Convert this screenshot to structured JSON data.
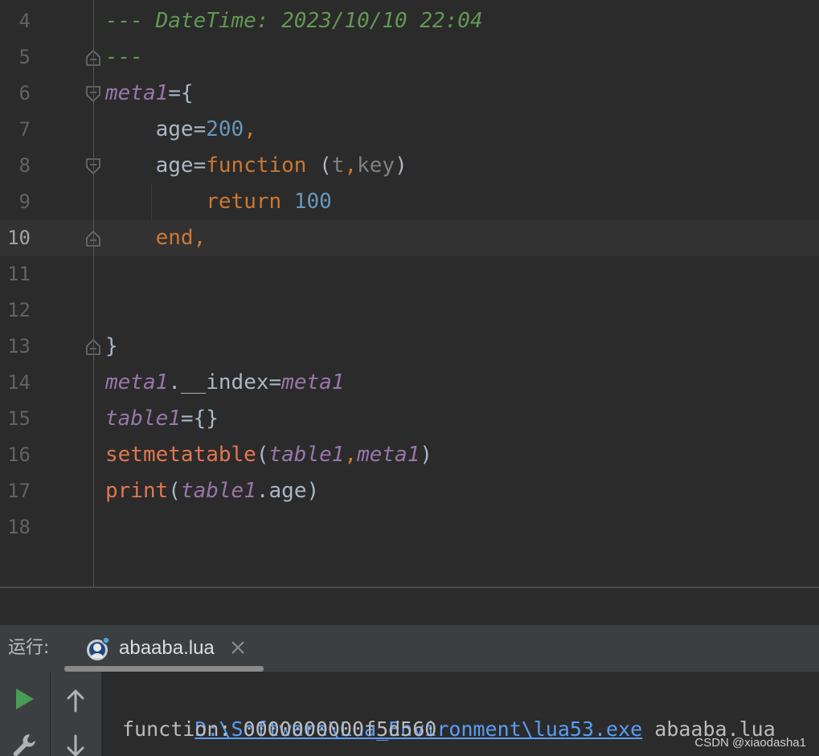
{
  "editor": {
    "lines": [
      {
        "num": "4",
        "tokens": [
          {
            "t": "--- DateTime: 2023/10/10 22:04",
            "c": "comment"
          }
        ]
      },
      {
        "num": "5",
        "tokens": [
          {
            "t": "---",
            "c": "comment"
          }
        ]
      },
      {
        "num": "6",
        "tokens": [
          {
            "t": "meta1",
            "c": "var"
          },
          {
            "t": "={",
            "c": "plain"
          }
        ]
      },
      {
        "num": "7",
        "tokens": [
          {
            "t": "    age=",
            "c": "plain"
          },
          {
            "t": "200",
            "c": "num"
          },
          {
            "t": ",",
            "c": "kw"
          }
        ]
      },
      {
        "num": "8",
        "tokens": [
          {
            "t": "    age=",
            "c": "plain"
          },
          {
            "t": "function",
            "c": "kw"
          },
          {
            "t": " (",
            "c": "plain"
          },
          {
            "t": "t",
            "c": "par"
          },
          {
            "t": ",",
            "c": "kw"
          },
          {
            "t": "key",
            "c": "par"
          },
          {
            "t": ")",
            "c": "plain"
          }
        ]
      },
      {
        "num": "9",
        "tokens": [
          {
            "t": "        ",
            "c": "plain"
          },
          {
            "t": "return",
            "c": "kw"
          },
          {
            "t": " ",
            "c": "plain"
          },
          {
            "t": "100",
            "c": "num"
          }
        ]
      },
      {
        "num": "10",
        "tokens": [
          {
            "t": "    ",
            "c": "plain"
          },
          {
            "t": "end,",
            "c": "kw"
          }
        ],
        "current": true
      },
      {
        "num": "11",
        "tokens": []
      },
      {
        "num": "12",
        "tokens": []
      },
      {
        "num": "13",
        "tokens": [
          {
            "t": "}",
            "c": "plain"
          }
        ]
      },
      {
        "num": "14",
        "tokens": [
          {
            "t": "meta1",
            "c": "var"
          },
          {
            "t": ".__index=",
            "c": "plain"
          },
          {
            "t": "meta1",
            "c": "var"
          }
        ]
      },
      {
        "num": "15",
        "tokens": [
          {
            "t": "table1",
            "c": "var"
          },
          {
            "t": "={}",
            "c": "plain"
          }
        ]
      },
      {
        "num": "16",
        "tokens": [
          {
            "t": "setmetatable",
            "c": "fn"
          },
          {
            "t": "(",
            "c": "plain"
          },
          {
            "t": "table1",
            "c": "var"
          },
          {
            "t": ",",
            "c": "kw"
          },
          {
            "t": "meta1",
            "c": "var"
          },
          {
            "t": ")",
            "c": "plain"
          }
        ]
      },
      {
        "num": "17",
        "tokens": [
          {
            "t": "print",
            "c": "fn"
          },
          {
            "t": "(",
            "c": "plain"
          },
          {
            "t": "table1",
            "c": "var"
          },
          {
            "t": ".age)",
            "c": "plain"
          }
        ]
      },
      {
        "num": "18",
        "tokens": []
      }
    ],
    "fold_markers": {
      "5": "end",
      "6": "start",
      "8": "start",
      "10": "end",
      "13": "end"
    }
  },
  "run_panel": {
    "label": "运行:",
    "tab_label": "abaaba.lua",
    "tab_icon": "lua-run-config-icon",
    "console": {
      "command_link": "D:\\Software\\Lua_Environment\\lua53.exe",
      "command_args": " abaaba.lua",
      "output": "function: 0000000000f5d560"
    }
  },
  "watermark": "CSDN @xiaodasha1",
  "colors": {
    "editor_bg": "#2b2b2b",
    "current_line_bg": "#323232",
    "comment": "#629755",
    "keyword": "#cc7832",
    "number": "#6897bb",
    "variable": "#9876aa",
    "function_call": "#e0774f",
    "run_icon": "#499c54",
    "link": "#589df6"
  }
}
